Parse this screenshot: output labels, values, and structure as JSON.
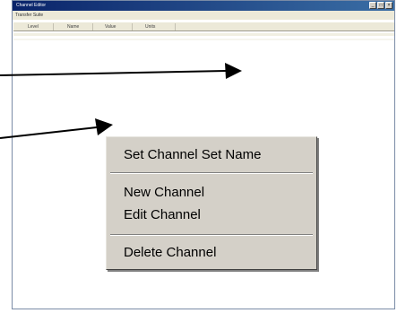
{
  "window": {
    "title": "Channel Editor",
    "menu": "Transfer Suite",
    "controls": [
      "_",
      "□",
      "×"
    ]
  },
  "columns": [
    "Level",
    "Name",
    "Value",
    "Units"
  ],
  "context_menu": {
    "items": [
      "Set Channel Set Name",
      "New Channel",
      "Edit Channel",
      "Delete Channel"
    ]
  },
  "colors": {
    "title_bar": "#0a246a",
    "menu_background": "#d4d0c8",
    "annotation_arrow": "#000000"
  }
}
